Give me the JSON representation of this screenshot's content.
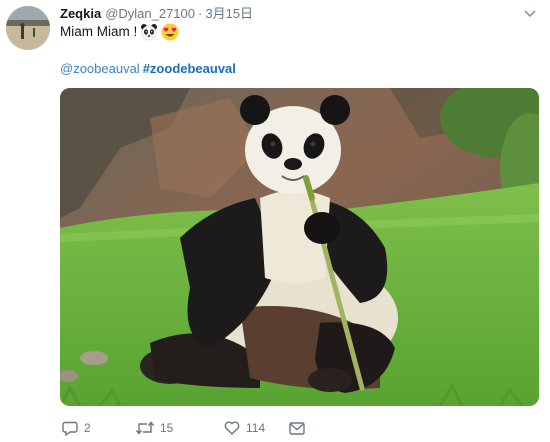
{
  "tweet": {
    "author": {
      "name": "Zeqkia",
      "handle": "@Dylan_27100",
      "separator": "·",
      "date": "3月15日"
    },
    "text": "Miam Miam !",
    "emojis": [
      "panda-face-icon",
      "heart-eyes-icon"
    ],
    "mention": "@zoobeauval",
    "hashtag": "#zoodebeauval",
    "actions": {
      "reply_count": "2",
      "retweet_count": "15",
      "like_count": "114"
    },
    "colors": {
      "link": "#3a86c6",
      "secondary_text": "#657786",
      "primary_text": "#14171a"
    }
  }
}
